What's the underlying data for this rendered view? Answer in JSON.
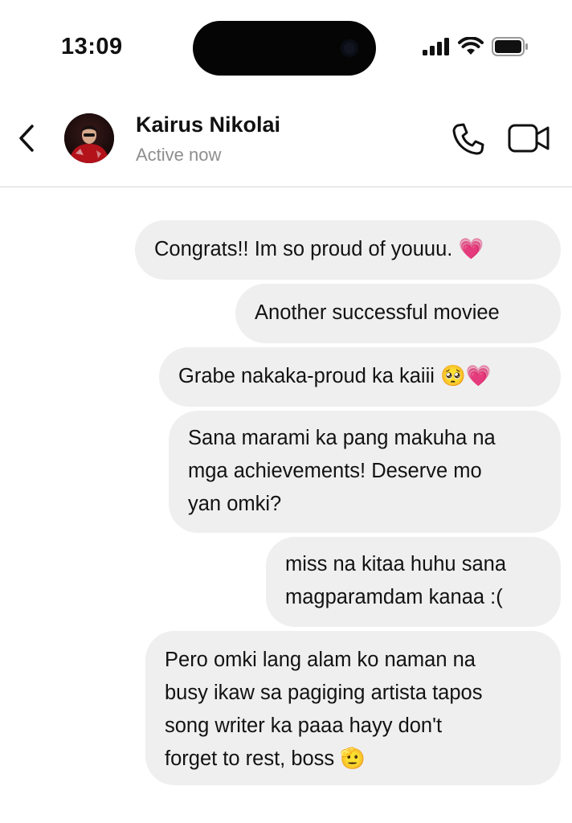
{
  "status_bar": {
    "time": "13:09",
    "signal_icon": "cellular-signal-icon",
    "wifi_icon": "wifi-icon",
    "battery_icon": "battery-icon"
  },
  "header": {
    "back_icon": "chevron-left-icon",
    "contact_name": "Kairus Nikolai",
    "contact_status": "Active now",
    "call_icon": "phone-icon",
    "video_icon": "video-camera-icon"
  },
  "messages": [
    {
      "text": "Congrats!! Im so proud of youuu. 💗",
      "sender": "me"
    },
    {
      "text": "Another successful moviee",
      "sender": "me"
    },
    {
      "text": "Grabe nakaka-proud ka kaiii 🥺💗",
      "sender": "me"
    },
    {
      "text": "Sana marami ka pang makuha na\nmga achievements! Deserve mo\nyan omki?",
      "sender": "me"
    },
    {
      "text": "miss na kitaa huhu sana\nmagparamdam kanaa :(",
      "sender": "me"
    },
    {
      "text": "Pero omki lang alam ko naman na\nbusy ikaw sa pagiging artista tapos\nsong writer ka paaa hayy don't\nforget to rest, boss 🫡",
      "sender": "me"
    }
  ],
  "colors": {
    "bubble": "#efefef",
    "text": "#121212",
    "secondary_text": "#8e8e8e",
    "divider": "#d8d8d8"
  }
}
